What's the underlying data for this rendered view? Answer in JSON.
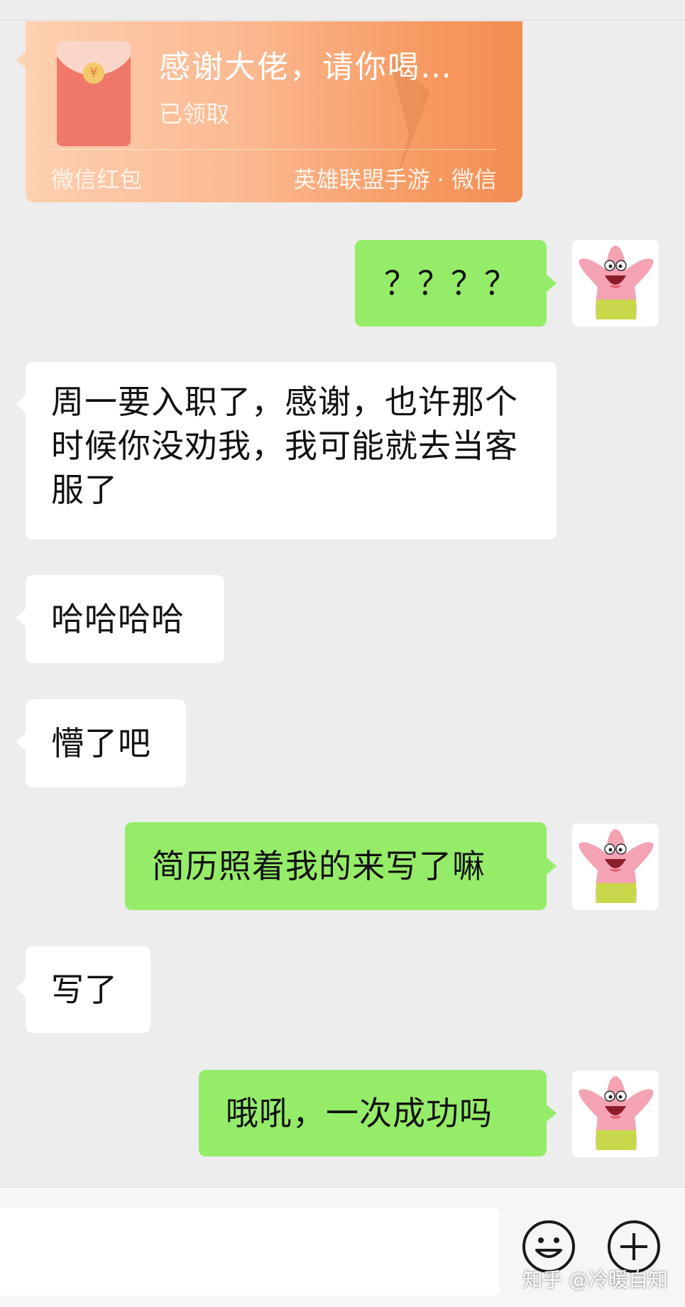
{
  "red_packet": {
    "title": "感谢大佬，请你喝…",
    "status": "已领取",
    "footer_left": "微信红包",
    "footer_right": "英雄联盟手游 · 微信"
  },
  "messages": [
    {
      "side": "out",
      "text": "？？？？"
    },
    {
      "side": "in",
      "text": "周一要入职了，感谢，也许那个时候你没劝我，我可能就去当客服了"
    },
    {
      "side": "in",
      "text": "哈哈哈哈"
    },
    {
      "side": "in",
      "text": "懵了吧"
    },
    {
      "side": "out",
      "text": "简历照着我的来写了嘛"
    },
    {
      "side": "in",
      "text": "写了"
    },
    {
      "side": "out",
      "text": "哦吼，一次成功吗"
    }
  ],
  "input_bar": {
    "placeholder": "",
    "emoji_icon": "smiley-face-icon",
    "more_icon": "plus-circle-icon"
  },
  "watermark": "知乎 @冷暖自知",
  "colors": {
    "background": "#ededed",
    "outgoing_bubble": "#95ec69",
    "incoming_bubble": "#ffffff",
    "red_packet": "#f79a62"
  }
}
